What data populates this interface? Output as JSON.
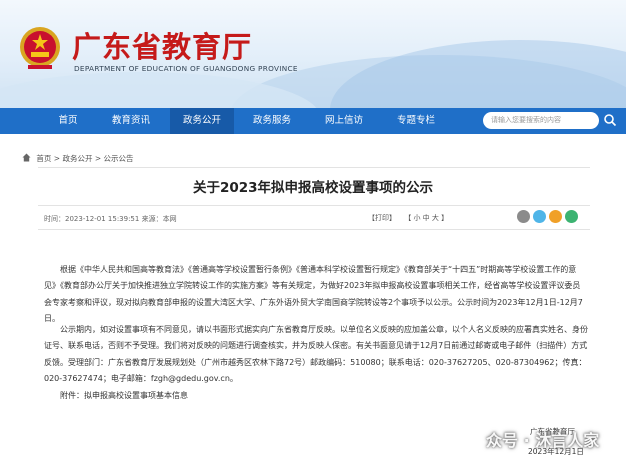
{
  "header": {
    "site_title": "广东省教育厅",
    "site_title_en": "DEPARTMENT OF EDUCATION OF GUANGDONG PROVINCE"
  },
  "nav": {
    "items": [
      {
        "label": "首页"
      },
      {
        "label": "教育资讯"
      },
      {
        "label": "政务公开"
      },
      {
        "label": "政务服务"
      },
      {
        "label": "网上信访"
      },
      {
        "label": "专题专栏"
      }
    ],
    "active_index": 2,
    "search_placeholder": "请输入您要搜索的内容"
  },
  "breadcrumb": {
    "items": [
      "首页",
      "政务公开",
      "公示公告"
    ],
    "separator": " > "
  },
  "article": {
    "title": "关于2023年拟申报高校设置事项的公示",
    "meta": "时间：2023-12-01 15:39:51  来源：本网",
    "print_label": "【打印】",
    "font_size_label": "【 小  中  大 】",
    "paragraph_1": "根据《中华人民共和国高等教育法》《普通高等学校设置暂行条例》《普通本科学校设置暂行规定》《教育部关于“十四五”时期高等学校设置工作的意见》《教育部办公厅关于加快推进独立学院转设工作的实施方案》等有关规定，为做好2023年拟申报高校设置事项相关工作，经省高等学校设置评议委员会专家考察和评议，现对拟向教育部申报的设置大湾区大学、广东外语外贸大学南国商学院转设等2个事项予以公示。公示时间为2023年12月1日-12月7日。",
    "paragraph_2": "公示期内，如对设置事项有不同意见，请以书面形式据实向广东省教育厅反映。以单位名义反映的应加盖公章，以个人名义反映的应署真实姓名、身份证号、联系电话，否则不予受理。我们将对反映的问题进行调查核实，并为反映人保密。有关书面意见请于12月7日前通过邮寄或电子邮件（扫描件）方式反馈。受理部门：广东省教育厅发展规划处（广州市越秀区农林下路72号）邮政编码：510080；联系电话：020-37627205、020-87304962；传真：020-37627474；电子邮箱：fzgh@gdedu.gov.cn。",
    "attachment": "附件：拟申报高校设置事项基本信息",
    "signature": "广东省教育厅",
    "date": "2023年12月1日"
  },
  "watermark": "众号 · 沐言人家",
  "colors": {
    "nav_blue": "#1f6fc8",
    "nav_active": "#175aa8",
    "brand_red": "#c51a1a"
  },
  "icons": [
    "emblem-icon",
    "home-icon",
    "search-icon",
    "share-icons"
  ]
}
